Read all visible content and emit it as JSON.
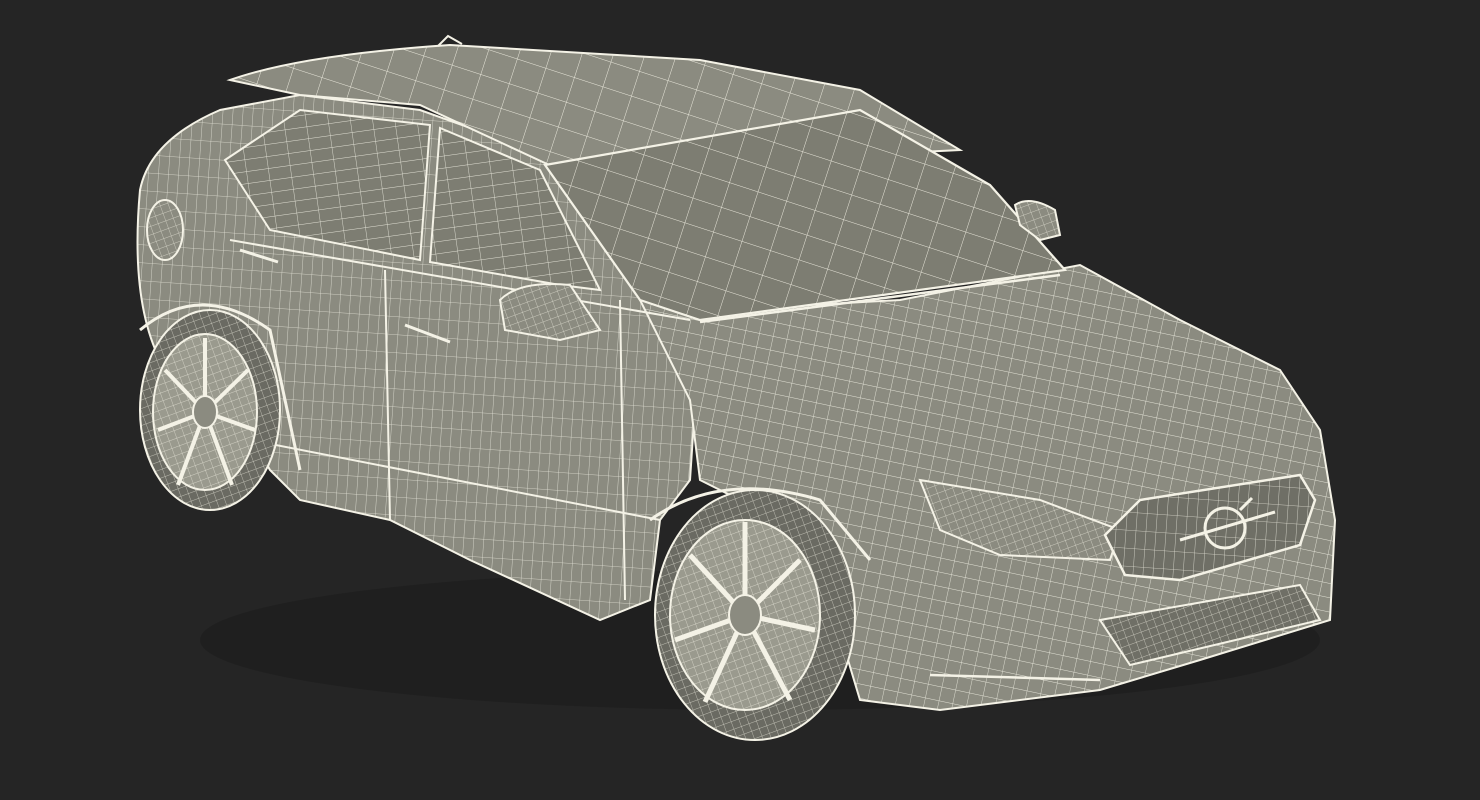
{
  "colors": {
    "background": "#252525",
    "body_fill": "#8b8b80",
    "body_shade": "#6f6f66",
    "glass_fill": "#7d7d72",
    "tire_fill": "#6a6a62",
    "rim_fill": "#9a9a8e",
    "wire": "#f4f2e6",
    "dark_gap": "#3a3a36"
  },
  "icons": {
    "grille_emblem": "volvo-iron-mark-icon"
  }
}
